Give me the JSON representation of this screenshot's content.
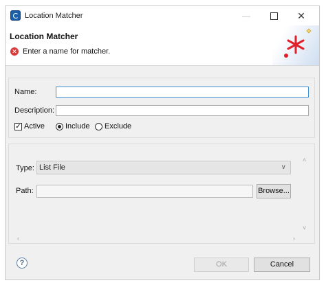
{
  "window": {
    "title": "Location Matcher",
    "minimize_glyph": "—",
    "close_glyph": "✕"
  },
  "header": {
    "title": "Location Matcher",
    "message": "Enter a name for matcher.",
    "error_glyph": "✕"
  },
  "form": {
    "name_label": "Name:",
    "name_value": "",
    "description_label": "Description:",
    "description_value": "",
    "active_label": "Active",
    "active_checked": true,
    "active_glyph": "✓",
    "include_label": "Include",
    "exclude_label": "Exclude",
    "selected_mode": "Include"
  },
  "details": {
    "type_label": "Type:",
    "type_value": "List File",
    "type_chevron": "∨",
    "path_label": "Path:",
    "path_value": "",
    "browse_label": "Browse...",
    "scroll_up": "˄",
    "scroll_down": "˅",
    "scroll_left": "‹",
    "scroll_right": "›"
  },
  "footer": {
    "help_glyph": "?",
    "ok_label": "OK",
    "ok_enabled": false,
    "cancel_label": "Cancel"
  },
  "colors": {
    "accent_red": "#e0202a",
    "focus_blue": "#3c8fd6",
    "error_red": "#d63b3b"
  },
  "icons": [
    "app-icon",
    "minimize-icon",
    "maximize-icon",
    "close-icon",
    "error-icon",
    "wizard-banner-icon",
    "help-icon",
    "chevron-down-icon"
  ]
}
